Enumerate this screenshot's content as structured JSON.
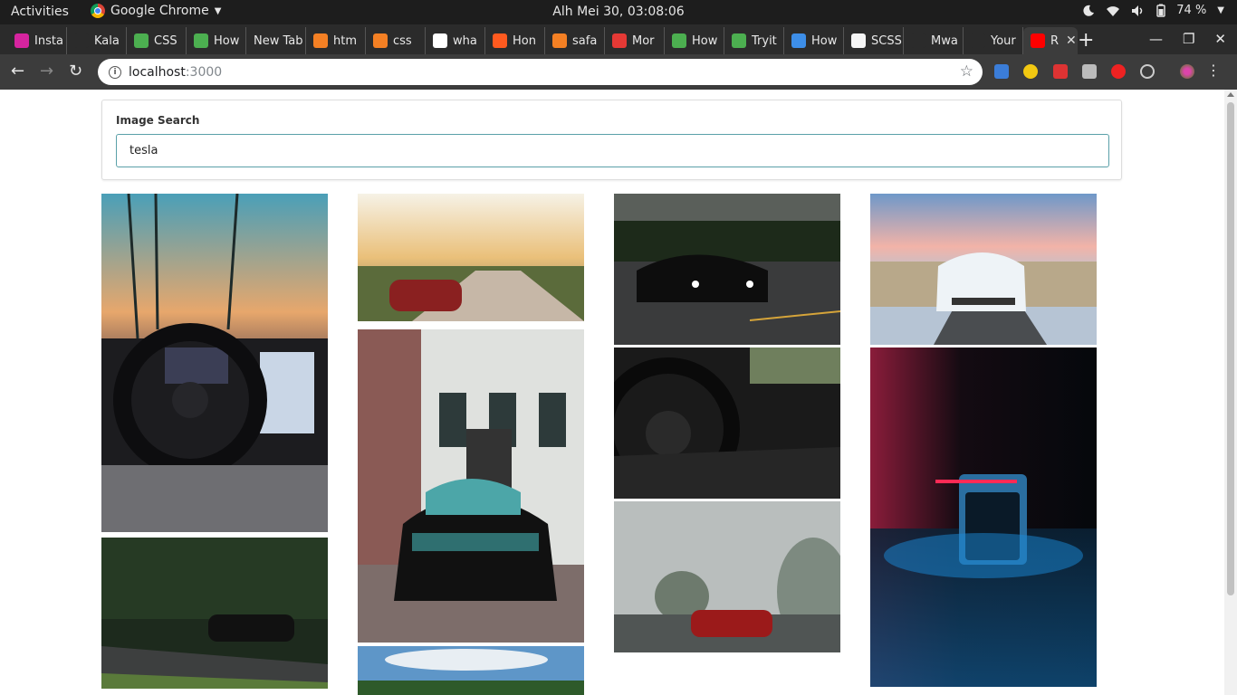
{
  "system_bar": {
    "activities": "Activities",
    "app_name": "Google Chrome",
    "clock": "Alh Mei 30, 03:08:06",
    "battery": "74 %"
  },
  "tabs": [
    {
      "title": "Insta",
      "icon": "instagram-icon",
      "color": "#d6249f"
    },
    {
      "title": "Kala",
      "icon": "k-icon",
      "color": "#2b2b2b"
    },
    {
      "title": "CSS",
      "icon": "w3-icon",
      "color": "#4caf50"
    },
    {
      "title": "How",
      "icon": "w3-icon",
      "color": "#4caf50"
    },
    {
      "title": "New Tab",
      "icon": "",
      "color": ""
    },
    {
      "title": "htm",
      "icon": "stackoverflow-icon",
      "color": "#f48024"
    },
    {
      "title": "css",
      "icon": "stackoverflow-icon",
      "color": "#f48024"
    },
    {
      "title": "wha",
      "icon": "google-icon",
      "color": "#ffffff"
    },
    {
      "title": "Hon",
      "icon": "circle-icon",
      "color": "#ff5a1f"
    },
    {
      "title": "safa",
      "icon": "stackoverflow-icon",
      "color": "#f48024"
    },
    {
      "title": "Mor",
      "icon": "f-icon",
      "color": "#e53935"
    },
    {
      "title": "How",
      "icon": "w3-icon",
      "color": "#4caf50"
    },
    {
      "title": "Tryit",
      "icon": "w3-icon",
      "color": "#4caf50"
    },
    {
      "title": "How",
      "icon": "spark-icon",
      "color": "#3d8ee8"
    },
    {
      "title": "SCSS",
      "icon": "bracket-icon",
      "color": "#f5f5f5"
    },
    {
      "title": "Mwa",
      "icon": "m-icon",
      "color": "#2b2b2b"
    },
    {
      "title": "Your",
      "icon": "github-icon",
      "color": "#2b2b2b"
    },
    {
      "title": "R",
      "icon": "youtube-icon",
      "color": "#ff0000"
    }
  ],
  "omnibox": {
    "host": "localhost",
    "port": ":3000"
  },
  "search": {
    "label": "Image Search",
    "value": "tesla"
  },
  "photos": [
    {
      "name": "photo-steering-palms"
    },
    {
      "name": "photo-red-sunset-road"
    },
    {
      "name": "photo-black-car-night"
    },
    {
      "name": "photo-white-model3-mountains"
    },
    {
      "name": "photo-black-car-brick-house"
    },
    {
      "name": "photo-steering-wheel-dark"
    },
    {
      "name": "photo-supercharger-neon"
    },
    {
      "name": "photo-red-car-fog"
    },
    {
      "name": "photo-black-car-forest-road"
    },
    {
      "name": "photo-sky-trees"
    }
  ]
}
